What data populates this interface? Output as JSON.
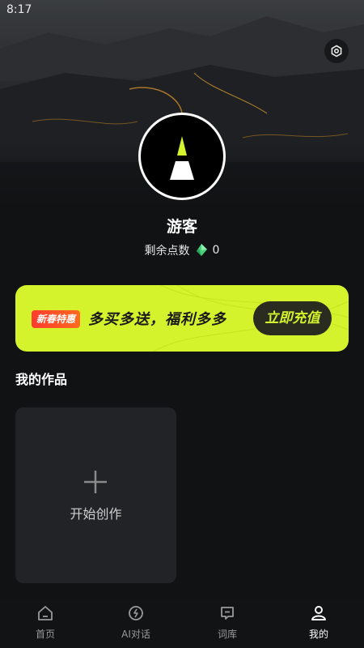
{
  "status_bar": {
    "time": "8:17"
  },
  "profile": {
    "username": "游客",
    "points_label": "剩余点数",
    "points_value": "0"
  },
  "banner": {
    "tag": "新春特惠",
    "slogan": "多买多送，福利多多",
    "cta": "立即充值"
  },
  "works": {
    "section_title": "我的作品",
    "create_label": "开始创作"
  },
  "tabbar": {
    "items": [
      {
        "label": "首页",
        "icon": "home-icon",
        "active": false
      },
      {
        "label": "AI对话",
        "icon": "ai-chat-icon",
        "active": false
      },
      {
        "label": "词库",
        "icon": "lexicon-icon",
        "active": false
      },
      {
        "label": "我的",
        "icon": "profile-icon",
        "active": true
      }
    ]
  },
  "colors": {
    "accent": "#d4f32c",
    "background": "#111214",
    "card": "#222326",
    "tag": "#ff3b2f"
  }
}
